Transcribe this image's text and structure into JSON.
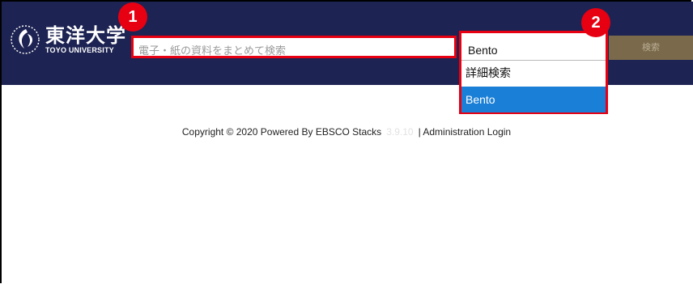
{
  "header": {
    "logo_jp": "東洋大学",
    "logo_en": "TOYO UNIVERSITY"
  },
  "search": {
    "placeholder": "電子・紙の資料をまとめて検索",
    "button_label": "検索"
  },
  "annotations": {
    "badge_1": "1",
    "badge_2": "2"
  },
  "dropdown": {
    "selected": "Bento",
    "options": [
      "詳細検索",
      "Bento"
    ],
    "active_option": "Bento"
  },
  "footer": {
    "copyright": "Copyright © 2020 Powered By EBSCO Stacks",
    "faint_text": "3.9.10",
    "separator": "|",
    "admin_link": "Administration Login"
  },
  "colors": {
    "header_bg": "#1d2352",
    "highlight": "#e60012",
    "active_option_bg": "#1a7fd6",
    "search_button_bg": "#7a6a4b"
  }
}
